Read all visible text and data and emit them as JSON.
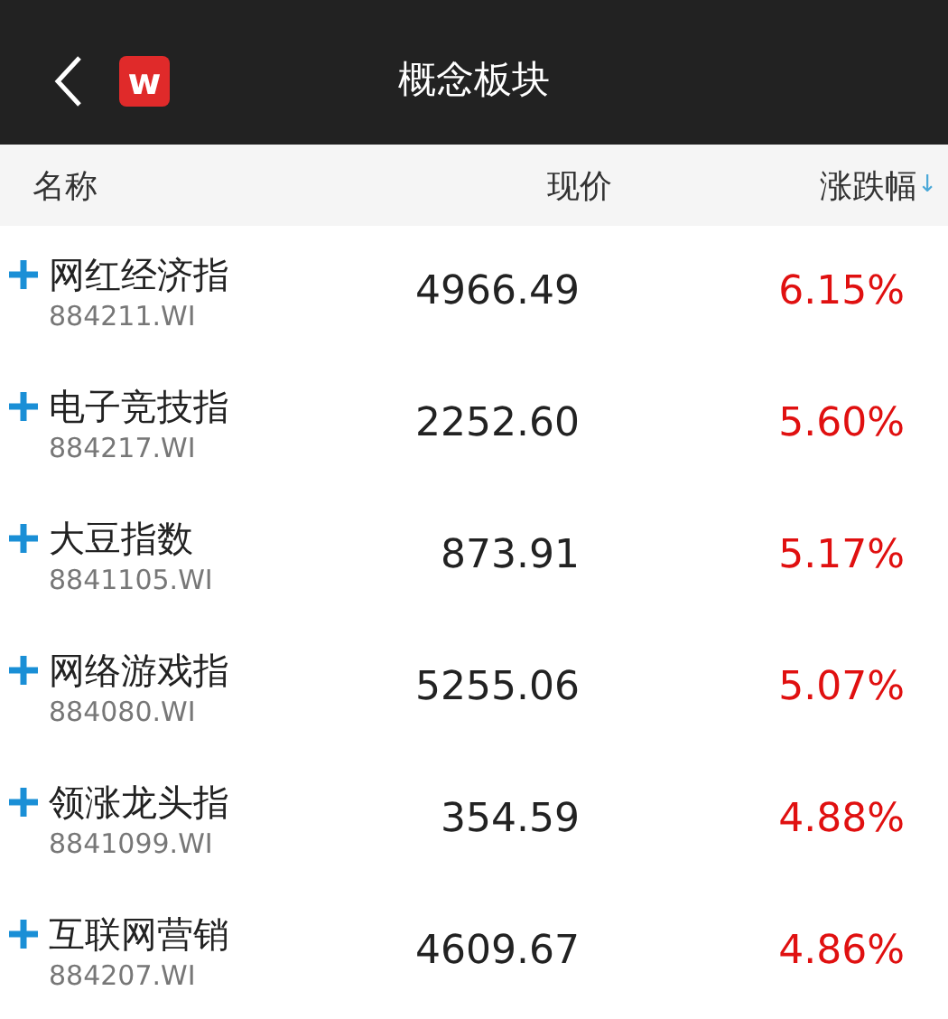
{
  "header": {
    "title": "概念板块",
    "logo": "w"
  },
  "columns": [
    {
      "label": "名称"
    },
    {
      "label": "现价"
    },
    {
      "label": "涨跌幅",
      "sort": "↓"
    }
  ],
  "rows": [
    {
      "name": "网红经济指",
      "code": "884211.WI",
      "price": "4966.49",
      "change": "6.15%"
    },
    {
      "name": "电子竞技指",
      "code": "884217.WI",
      "price": "2252.60",
      "change": "5.60%"
    },
    {
      "name": "大豆指数",
      "code": "8841105.WI",
      "price": "873.91",
      "change": "5.17%"
    },
    {
      "name": "网络游戏指",
      "code": "884080.WI",
      "price": "5255.06",
      "change": "5.07%"
    },
    {
      "name": "领涨龙头指",
      "code": "8841099.WI",
      "price": "354.59",
      "change": "4.88%"
    },
    {
      "name": "互联网营销",
      "code": "884207.WI",
      "price": "4609.67",
      "change": "4.86%"
    }
  ]
}
